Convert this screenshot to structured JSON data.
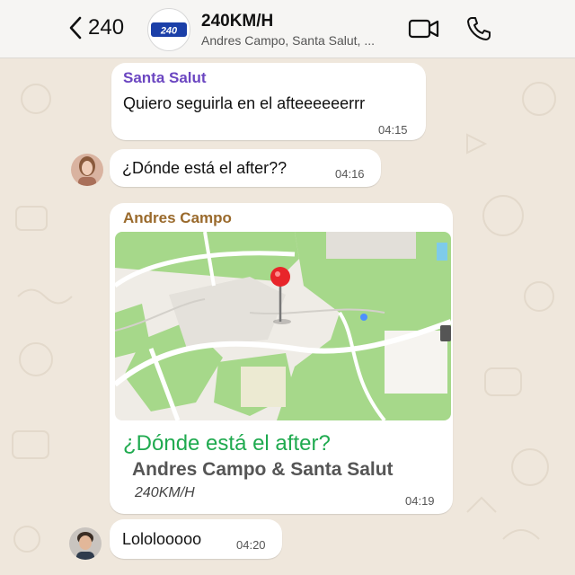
{
  "header": {
    "back_count": "240",
    "group_name": "240KM/H",
    "group_members": "Andres Campo, Santa Salut, ...",
    "group_logo_text": "240"
  },
  "messages": [
    {
      "sender": "Santa Salut",
      "text": "Quiero seguirla en el afteeeeeerrr",
      "time": "04:15",
      "sender_color": "#6b46c1"
    },
    {
      "sender": "",
      "text": "¿Dónde está el after??",
      "time": "04:16"
    },
    {
      "sender": "Andres Campo",
      "sender_color": "#9a6a2c",
      "time": "04:19",
      "location": {
        "title": "¿Dónde está el after?",
        "people": "Andres Campo & Santa Salut",
        "group": "240KM/H"
      }
    },
    {
      "sender": "",
      "text": "Lololooooo",
      "time": "04:20"
    }
  ],
  "colors": {
    "location_title": "#1faa4f",
    "map_park": "#a6d88a",
    "map_pin": "#e8252a"
  },
  "icons": [
    "chevron-left-icon",
    "video-call-icon",
    "phone-icon",
    "map-pin-icon"
  ]
}
